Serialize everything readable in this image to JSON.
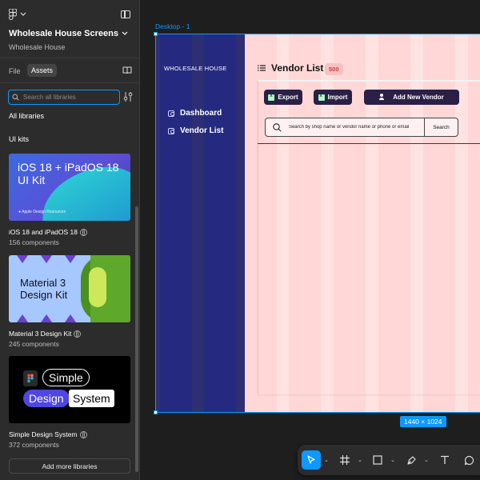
{
  "file": {
    "name": "Wholesale House Screens",
    "team": "Wholesale House"
  },
  "panel_tabs": {
    "file": "File",
    "assets": "Assets"
  },
  "search": {
    "placeholder": "Search all libraries"
  },
  "sections": {
    "all_libraries": "All libraries",
    "ui_kits": "UI kits"
  },
  "kits": [
    {
      "name": "iOS 18 and iPadOS 18",
      "count": "156 components",
      "thumb_title_line1": "iOS 18 + iPadOS 18",
      "thumb_title_line2": "UI Kit",
      "thumb_footer": "Apple Design Resources"
    },
    {
      "name": "Material 3 Design Kit",
      "count": "245 components",
      "thumb_title_line1": "Material 3",
      "thumb_title_line2": "Design Kit"
    },
    {
      "name": "Simple Design System",
      "count": "372 components",
      "thumb_word1": "Simple",
      "thumb_word2": "Design",
      "thumb_word3": "System"
    }
  ],
  "add_libraries_label": "Add more libraries",
  "canvas": {
    "frame_label": "Desktop - 1",
    "size_badge": "1440 × 1024"
  },
  "design": {
    "brand": "WHOLESALE HOUSE",
    "nav": [
      "Dashboard",
      "Vendor List"
    ],
    "page_title": "Vendor List",
    "count_badge": "500",
    "buttons": {
      "export": "Export",
      "import": "Import",
      "add_vendor": "Add New Vendor"
    },
    "search_placeholder": "Search by shop name or vendor name or phone or email",
    "search_button": "Search"
  },
  "colors": {
    "accent": "#0d99ff",
    "nav_bg": "#2e2f73",
    "frame_bg": "#ffe2e2",
    "button_bg": "#2b1f46",
    "badge_text": "#d23b3b"
  }
}
